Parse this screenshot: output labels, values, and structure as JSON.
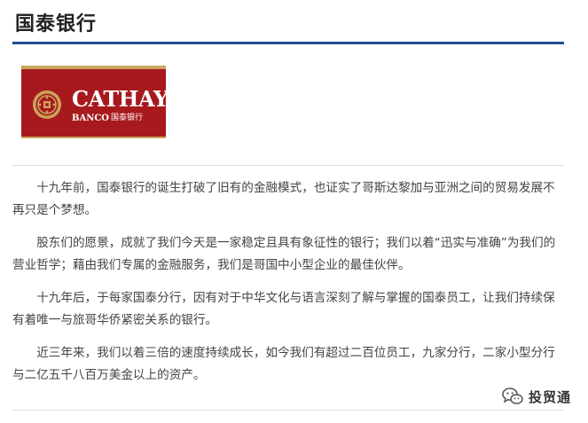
{
  "header": {
    "title": "国泰银行"
  },
  "logo": {
    "wordmark": "CATHAY",
    "sub": "BANCO",
    "chinese": "国泰银行"
  },
  "article": {
    "paragraphs": [
      "十九年前，国泰银行的诞生打破了旧有的金融模式，也证实了哥斯达黎加与亚洲之间的贸易发展不再只是个梦想。",
      "股东们的愿景，成就了我们今天是一家稳定且具有象征性的银行；我们以着“迅实与准确”为我们的营业哲学；藉由我们专属的金融服务，我们是哥国中小型企业的最佳伙伴。",
      "十九年后，于每家国泰分行，因有对于中华文化与语言深刻了解与掌握的国泰员工，让我们持续保有着唯一与旅哥华侨紧密关系的银行。",
      "近三年来，我们以着三倍的速度持续成长，如今我们有超过二百位员工，九家分行，二家小型分行与二亿五千八百万美金以上的资产。"
    ]
  },
  "watermark": {
    "text": "投贸通",
    "icon": "wechat-icon"
  },
  "colors": {
    "accent": "#1f4e93",
    "logo_red": "#a8191e",
    "logo_gold": "#c9a55c",
    "text": "#444444"
  }
}
